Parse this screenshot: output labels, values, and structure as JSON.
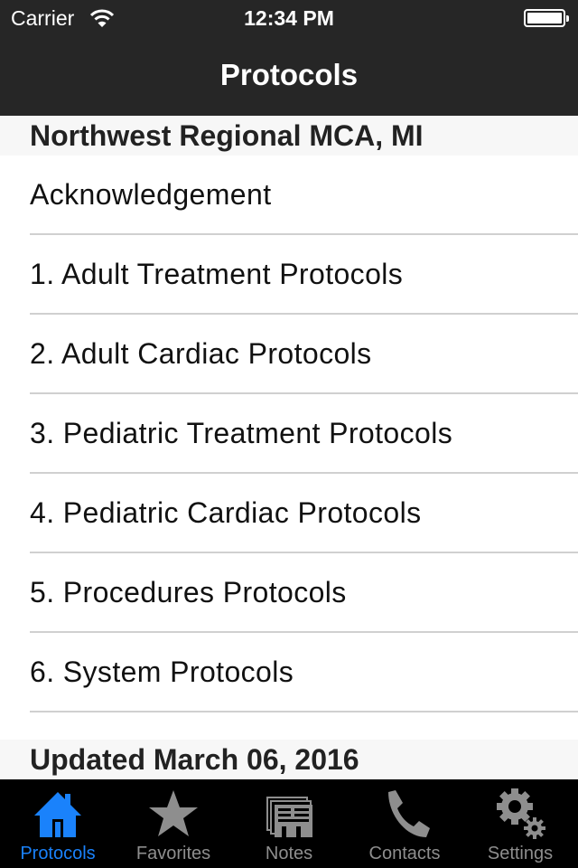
{
  "status_bar": {
    "carrier": "Carrier",
    "time": "12:34 PM",
    "wifi_icon": "wifi-icon",
    "battery_icon": "battery-icon",
    "battery_level": 1.0
  },
  "nav": {
    "title": "Protocols"
  },
  "sections": {
    "header": "Northwest Regional MCA, MI",
    "footer": "Updated March 06, 2016"
  },
  "list": {
    "items": [
      {
        "label": "Acknowledgement"
      },
      {
        "label": "1. Adult Treatment Protocols"
      },
      {
        "label": "2. Adult Cardiac Protocols"
      },
      {
        "label": "3. Pediatric Treatment Protocols"
      },
      {
        "label": "4. Pediatric Cardiac Protocols"
      },
      {
        "label": "5. Procedures Protocols"
      },
      {
        "label": "6. System Protocols"
      }
    ]
  },
  "tabbar": {
    "active_color": "#1a82fb",
    "inactive_color": "#8e8e8e",
    "tabs": [
      {
        "label": "Protocols",
        "icon": "home-icon",
        "active": true
      },
      {
        "label": "Favorites",
        "icon": "star-icon",
        "active": false
      },
      {
        "label": "Notes",
        "icon": "notes-icon",
        "active": false
      },
      {
        "label": "Contacts",
        "icon": "phone-icon",
        "active": false
      },
      {
        "label": "Settings",
        "icon": "gears-icon",
        "active": false
      }
    ]
  }
}
